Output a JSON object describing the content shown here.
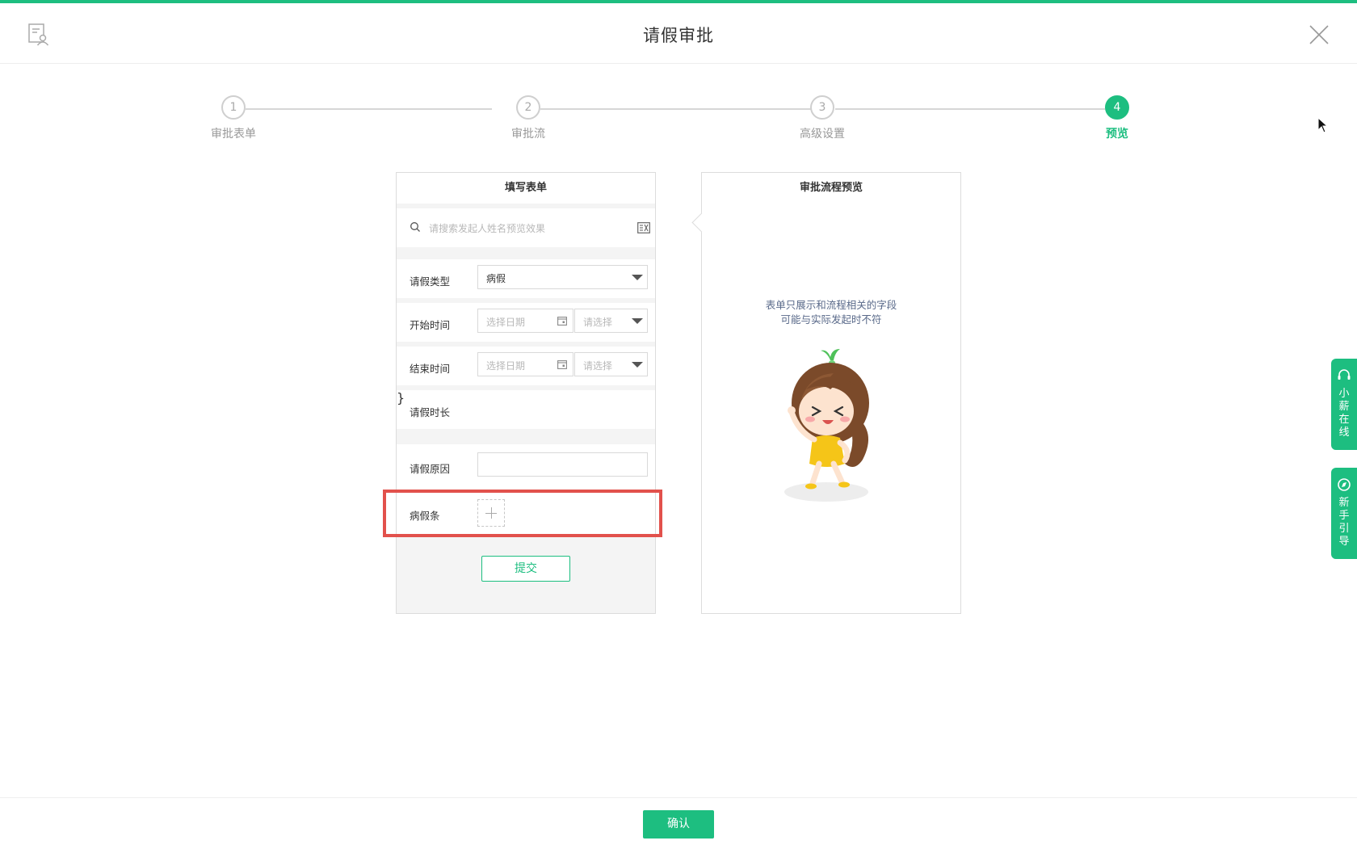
{
  "header": {
    "title": "请假审批",
    "app_icon": "form-user-icon",
    "close_icon": "close-icon"
  },
  "steps": [
    {
      "number": "1",
      "label": "审批表单",
      "active": false
    },
    {
      "number": "2",
      "label": "审批流",
      "active": false
    },
    {
      "number": "3",
      "label": "高级设置",
      "active": false
    },
    {
      "number": "4",
      "label": "预览",
      "active": true
    }
  ],
  "form": {
    "title": "填写表单",
    "search_placeholder": "请搜索发起人姓名预览效果",
    "fields": {
      "leave_type": {
        "label": "请假类型",
        "value": "病假"
      },
      "start_time": {
        "label": "开始时间",
        "date_placeholder": "选择日期",
        "time_placeholder": "请选择"
      },
      "end_time": {
        "label": "结束时间",
        "date_placeholder": "选择日期",
        "time_placeholder": "请选择"
      },
      "duration": {
        "label": "请假时长"
      },
      "reason": {
        "label": "请假原因",
        "value": ""
      },
      "sick_note": {
        "label": "病假条"
      }
    },
    "submit_label": "提交"
  },
  "preview": {
    "title": "审批流程预览",
    "note_line1": "表单只展示和流程相关的字段",
    "note_line2": "可能与实际发起时不符"
  },
  "side_tabs": [
    {
      "label_chars": [
        "小",
        "薪",
        "在",
        "线"
      ],
      "icon": "headset-icon"
    },
    {
      "label_chars": [
        "新",
        "手",
        "引",
        "导"
      ],
      "icon": "compass-icon"
    }
  ],
  "footer": {
    "confirm_label": "确认"
  },
  "colors": {
    "accent": "#1dbe80",
    "highlight": "#e2514c"
  }
}
